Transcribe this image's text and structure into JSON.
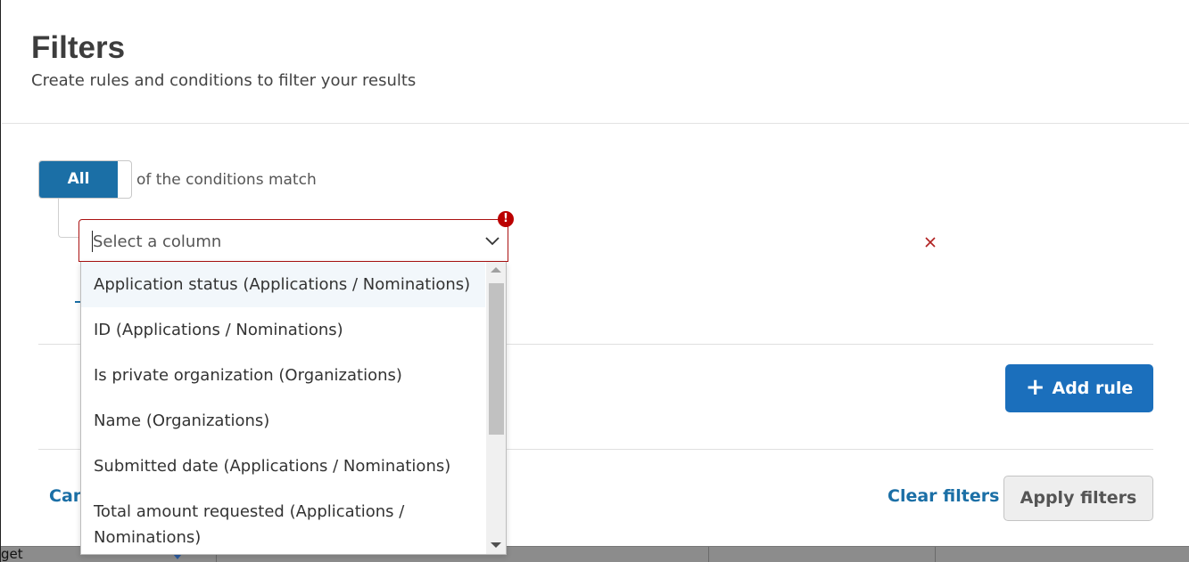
{
  "modal": {
    "title": "Filters",
    "subtitle": "Create rules and conditions to filter your results"
  },
  "match": {
    "toggle_label": "All",
    "suffix": "of the conditions match"
  },
  "rule": {
    "select_placeholder": "Select a column",
    "error_icon": "exclamation-icon",
    "remove_icon": "close-icon"
  },
  "dropdown": {
    "options": [
      "Application status (Applications / Nominations)",
      "ID (Applications / Nominations)",
      "Is private organization (Organizations)",
      "Name (Organizations)",
      "Submitted date (Applications / Nominations)",
      "Total amount requested (Applications /",
      "Nominations)"
    ]
  },
  "actions": {
    "add_rule": "Add rule",
    "cancel_partial": "Can",
    "clear_filters": "Clear filters",
    "apply_filters": "Apply filters"
  },
  "background": {
    "cell_text": "get"
  },
  "colors": {
    "primary": "#1b6fa6",
    "button_blue": "#1b6fbc",
    "error": "#b00000"
  }
}
